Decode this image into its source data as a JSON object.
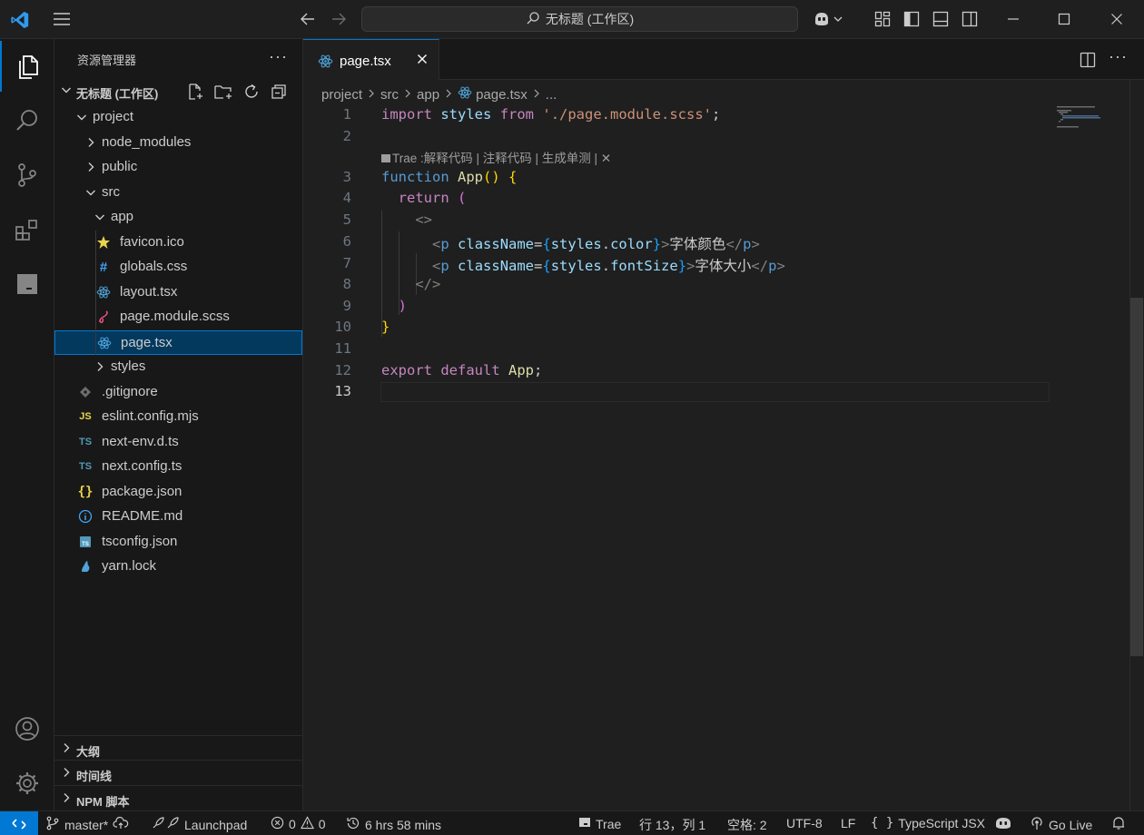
{
  "titlebar": {
    "search_text": "无标题 (工作区)"
  },
  "sidebar": {
    "title": "资源管理器",
    "workspace": "无标题 (工作区)",
    "tree": [
      {
        "name": "project",
        "type": "folder-open",
        "depth": 1
      },
      {
        "name": "node_modules",
        "type": "folder",
        "depth": 2
      },
      {
        "name": "public",
        "type": "folder",
        "depth": 2
      },
      {
        "name": "src",
        "type": "folder-open",
        "depth": 2
      },
      {
        "name": "app",
        "type": "folder-open",
        "depth": 3
      },
      {
        "name": "favicon.ico",
        "type": "favicon",
        "depth": 4
      },
      {
        "name": "globals.css",
        "type": "css",
        "depth": 4
      },
      {
        "name": "layout.tsx",
        "type": "react",
        "depth": 4
      },
      {
        "name": "page.module.scss",
        "type": "scss",
        "depth": 4
      },
      {
        "name": "page.tsx",
        "type": "react",
        "depth": 4,
        "selected": true
      },
      {
        "name": "styles",
        "type": "folder",
        "depth": 3
      },
      {
        "name": ".gitignore",
        "type": "git",
        "depth": 2
      },
      {
        "name": "eslint.config.mjs",
        "type": "js",
        "depth": 2
      },
      {
        "name": "next-env.d.ts",
        "type": "ts",
        "depth": 2
      },
      {
        "name": "next.config.ts",
        "type": "ts",
        "depth": 2
      },
      {
        "name": "package.json",
        "type": "json",
        "depth": 2
      },
      {
        "name": "README.md",
        "type": "info",
        "depth": 2
      },
      {
        "name": "tsconfig.json",
        "type": "tsconfig",
        "depth": 2
      },
      {
        "name": "yarn.lock",
        "type": "yarn",
        "depth": 2
      }
    ],
    "panels": [
      "大纲",
      "时间线",
      "NPM 脚本"
    ]
  },
  "editor": {
    "tab_label": "page.tsx",
    "breadcrumb": [
      "project",
      "src",
      "app",
      "page.tsx",
      "..."
    ],
    "codelens": "Trae :解释代码 | 注释代码 | 生成单测 |",
    "line_numbers": [
      "1",
      "2",
      "3",
      "4",
      "5",
      "6",
      "7",
      "8",
      "9",
      "10",
      "11",
      "12",
      "13"
    ],
    "current_line": 13
  },
  "statusbar": {
    "branch": "master*",
    "launchpad": "Launchpad",
    "errors": "0",
    "warnings": "0",
    "time": "6 hrs 58 mins",
    "trae": "Trae",
    "position": "行 13，列 1",
    "spaces": "空格: 2",
    "encoding": "UTF-8",
    "eol": "LF",
    "language": "TypeScript JSX",
    "golive": "Go Live"
  },
  "colors": {
    "accent": "#0078d4",
    "selection": "#04395e",
    "background": "#1f1f1f",
    "sidebar_bg": "#181818"
  }
}
